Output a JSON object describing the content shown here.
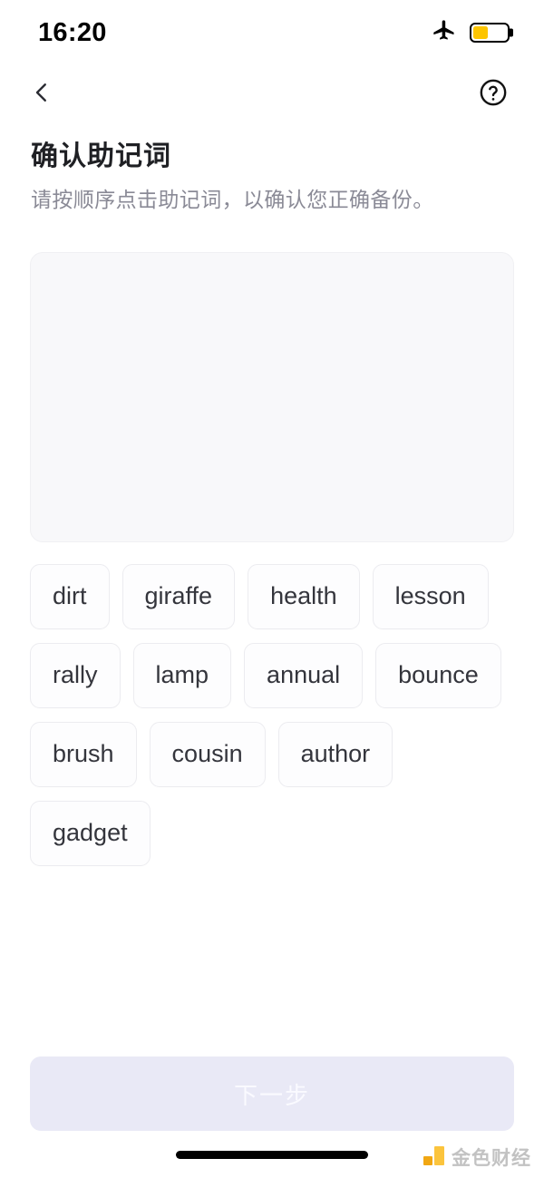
{
  "status_bar": {
    "time": "16:20",
    "airplane_icon": "airplane-icon",
    "battery_icon": "battery-icon",
    "battery_level_percent": 45,
    "battery_color": "#fdc500"
  },
  "nav": {
    "back_icon": "chevron-left-icon",
    "help_icon": "question-circle-icon"
  },
  "heading": {
    "title": "确认助记词",
    "subtitle": "请按顺序点击助记词，以确认您正确备份。"
  },
  "answer_box": {
    "selected_words": []
  },
  "word_pool": {
    "words": [
      "dirt",
      "giraffe",
      "health",
      "lesson",
      "rally",
      "lamp",
      "annual",
      "bounce",
      "brush",
      "cousin",
      "author",
      "gadget"
    ]
  },
  "footer": {
    "next_label": "下一步",
    "next_disabled": true,
    "next_bg_color": "#e9e9f6",
    "next_text_color": "#fafaff"
  },
  "watermark": {
    "text": "金色财经",
    "logo_color": "#fbc02d"
  }
}
